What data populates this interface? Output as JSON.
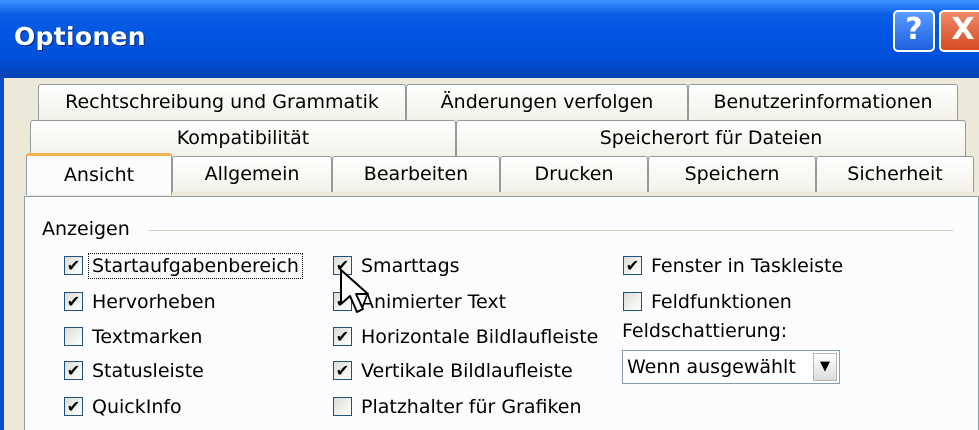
{
  "window": {
    "title": "Optionen",
    "help_glyph": "?",
    "close_glyph": "X"
  },
  "tabs": {
    "row1": [
      "Rechtschreibung und Grammatik",
      "Änderungen verfolgen",
      "Benutzerinformationen"
    ],
    "row2": [
      "Kompatibilität",
      "Speicherort für Dateien"
    ],
    "row3": [
      "Ansicht",
      "Allgemein",
      "Bearbeiten",
      "Drucken",
      "Speichern",
      "Sicherheit"
    ],
    "active": "Ansicht"
  },
  "group": {
    "label": "Anzeigen"
  },
  "checkboxes": {
    "startaufgabenbereich": {
      "label": "Startaufgabenbereich",
      "checked": true
    },
    "hervorheben": {
      "label": "Hervorheben",
      "checked": true
    },
    "textmarken": {
      "label": "Textmarken",
      "checked": false
    },
    "statusleiste": {
      "label": "Statusleiste",
      "checked": true
    },
    "quickinfo": {
      "label": "QuickInfo",
      "checked": true
    },
    "smarttags": {
      "label": "Smarttags",
      "checked": true
    },
    "animierter_text": {
      "label": "Animierter Text",
      "checked": true
    },
    "horizontale_bildlaufleiste": {
      "label": "Horizontale Bildlaufleiste",
      "checked": true
    },
    "vertikale_bildlaufleiste": {
      "label": "Vertikale Bildlaufleiste",
      "checked": true
    },
    "platzhalter_grafiken": {
      "label": "Platzhalter für Grafiken",
      "checked": false
    },
    "fenster_taskleiste": {
      "label": "Fenster in Taskleiste",
      "checked": true
    },
    "feldfunktionen": {
      "label": "Feldfunktionen",
      "checked": false
    }
  },
  "field_shading": {
    "label": "Feldschattierung:",
    "value": "Wenn ausgewählt",
    "arrow": "▼"
  },
  "icons": {
    "cursor": "arrow-cursor-icon",
    "checkmark": "checkmark-icon"
  }
}
